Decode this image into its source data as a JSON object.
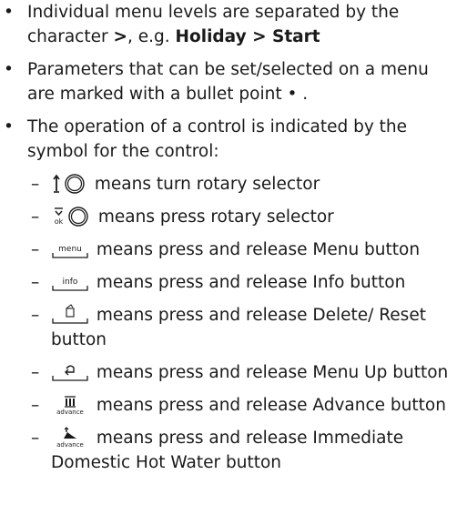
{
  "bullets": [
    {
      "marker": "•",
      "part1": "Individual menu levels are separated by the character ",
      "sep_symbol": ">",
      "part2": ", e.g. ",
      "example": "Holiday > Start"
    },
    {
      "marker": "•",
      "text": "Parameters that can be set/selected on a menu are marked with a bullet point • ."
    },
    {
      "marker": "•",
      "text": "The operation of a control is indicated by the symbol for the control:"
    }
  ],
  "controls": [
    {
      "dash": "–",
      "icon": "turn-rotary-selector-icon",
      "text": "means turn rotary selector"
    },
    {
      "dash": "–",
      "icon": "press-rotary-selector-icon",
      "icon_text": "ok",
      "text": "means press rotary selector"
    },
    {
      "dash": "–",
      "icon": "menu-button-icon",
      "icon_text": "menu",
      "text": "means press and release Menu button"
    },
    {
      "dash": "–",
      "icon": "info-button-icon",
      "icon_text": "info",
      "text": "means press and release Info button"
    },
    {
      "dash": "–",
      "icon": "delete-reset-button-icon",
      "text": "means press and release Delete/ Reset button"
    },
    {
      "dash": "–",
      "icon": "menu-up-button-icon",
      "text": "means press and release Menu Up button"
    },
    {
      "dash": "–",
      "icon": "advance-button-icon",
      "icon_text": "advance",
      "text": "means press and release Advance button"
    },
    {
      "dash": "–",
      "icon": "immediate-dhw-button-icon",
      "icon_text": "advance",
      "text": "means press and release Immediate Domestic Hot Water button"
    }
  ]
}
